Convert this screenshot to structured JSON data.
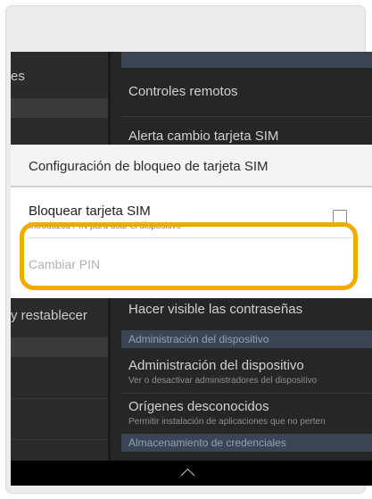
{
  "left_pane": {
    "item_top": "es",
    "item_bottom": "y restablecer"
  },
  "right_pane": {
    "items": [
      {
        "title": "Controles remotos"
      },
      {
        "title": "Alerta cambio tarjeta SIM"
      },
      {
        "title": "Hacer visible las contraseñas"
      }
    ],
    "section_admin": "Administración del dispositivo",
    "admin_item": {
      "title": "Administración del dispositivo",
      "subtitle": "Ver o desactivar administradores del dispositivo"
    },
    "origins_item": {
      "title": "Orígenes desconocidos",
      "subtitle": "Permitir instalación de aplicaciones que no perten"
    },
    "section_credentials": "Almacenamiento de credenciales"
  },
  "dialog": {
    "title": "Configuración de bloqueo de tarjeta SIM",
    "lock_option": {
      "title": "Bloquear tarjeta SIM",
      "subtitle": "Introduzca PIN para usar el dispositivo",
      "checked": false
    },
    "change_pin_label": "Cambiar PIN"
  },
  "navbar": {
    "icon": "chevron-up-icon"
  },
  "colors": {
    "highlight": "#f2a900"
  }
}
